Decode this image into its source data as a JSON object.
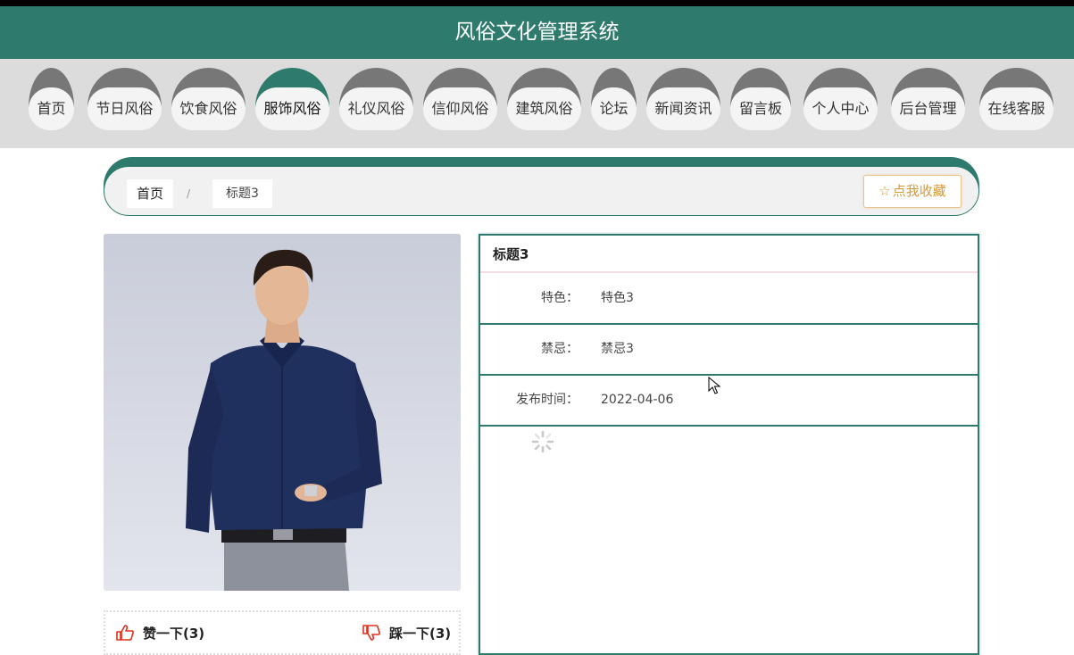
{
  "header": {
    "title": "风俗文化管理系统"
  },
  "nav": {
    "items": [
      {
        "label": "首页",
        "active": false
      },
      {
        "label": "节日风俗",
        "active": false
      },
      {
        "label": "饮食风俗",
        "active": false
      },
      {
        "label": "服饰风俗",
        "active": true
      },
      {
        "label": "礼仪风俗",
        "active": false
      },
      {
        "label": "信仰风俗",
        "active": false
      },
      {
        "label": "建筑风俗",
        "active": false
      },
      {
        "label": "论坛",
        "active": false
      },
      {
        "label": "新闻资讯",
        "active": false
      },
      {
        "label": "留言板",
        "active": false
      },
      {
        "label": "个人中心",
        "active": false
      },
      {
        "label": "后台管理",
        "active": false
      },
      {
        "label": "在线客服",
        "active": false
      }
    ]
  },
  "breadcrumb": {
    "home": "首页",
    "separator": "/",
    "current": "标题3"
  },
  "favorite_button": {
    "label": "点我收藏",
    "icon": "star-outline-icon"
  },
  "vote": {
    "like_label": "赞一下(3)",
    "dislike_label": "踩一下(3)",
    "like_icon": "thumbs-up-icon",
    "dislike_icon": "thumbs-down-icon"
  },
  "detail": {
    "title": "标题3",
    "fields": [
      {
        "label": "特色：",
        "value": "特色3"
      },
      {
        "label": "禁忌：",
        "value": "禁忌3"
      },
      {
        "label": "发布时间：",
        "value": "2022-04-06"
      }
    ]
  },
  "colors": {
    "primary": "#2e7a6c",
    "nav_inactive": "#777777",
    "accent": "#d59a3d",
    "vote_icon": "#e0301e"
  }
}
